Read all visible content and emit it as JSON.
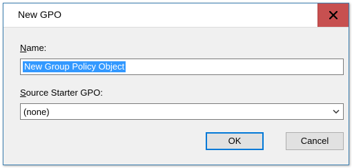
{
  "window": {
    "title": "New GPO",
    "close_label": "close"
  },
  "form": {
    "name_label_accesskey": "N",
    "name_label_rest": "ame:",
    "name_value": "New Group Policy Object",
    "starter_label_accesskey": "S",
    "starter_label_rest": "ource Starter GPO:",
    "starter_selected": "(none)"
  },
  "buttons": {
    "ok": "OK",
    "cancel": "Cancel"
  },
  "colors": {
    "close_button": "#c75050",
    "selection": "#3399ff",
    "default_button_border": "#0078d7"
  },
  "icons": {
    "close": "close-icon",
    "dropdown": "chevron-down-icon"
  }
}
